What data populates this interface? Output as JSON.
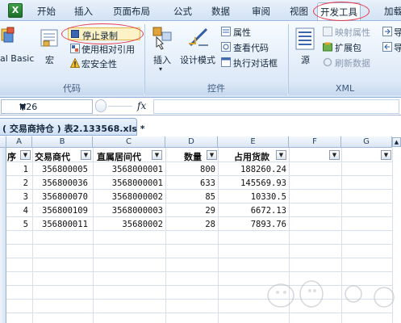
{
  "ribbon": {
    "tabs": [
      "开始",
      "插入",
      "页面布局",
      "公式",
      "数据",
      "审阅",
      "视图",
      "开发工具",
      "加载"
    ],
    "active_tab": "开发工具",
    "code_group": {
      "label": "代码",
      "macro_label": "宏",
      "visual_basic_partial": "al Basic",
      "stop_recording": "停止录制",
      "relative_ref": "使用相对引用",
      "macro_security": "宏安全性"
    },
    "controls_group": {
      "label": "控件",
      "insert": "插入",
      "design_mode": "设计模式",
      "properties": "属性",
      "view_code": "查看代码",
      "run_dialog": "执行对话框"
    },
    "xml_group": {
      "label": "XML",
      "source": "源",
      "map_properties": "映射属性",
      "expansion_pack": "扩展包",
      "refresh_data": "刷新数据",
      "import_partial": "导",
      "export_partial": "导"
    }
  },
  "formula_bar": {
    "name_box": "H26",
    "fx": "fx",
    "formula": ""
  },
  "workbook": {
    "title": "( 交易商持仓 ) 表2.133568.xls *"
  },
  "grid": {
    "columns": [
      "A",
      "B",
      "C",
      "D",
      "E",
      "F",
      "G"
    ],
    "headers": [
      "序",
      "交易商代",
      "直属居间代",
      "数量",
      "占用货款"
    ],
    "rows": [
      [
        "1",
        "356800005",
        "3568000001",
        "800",
        "188260.24"
      ],
      [
        "2",
        "356800036",
        "3568000001",
        "633",
        "145569.93"
      ],
      [
        "3",
        "356800070",
        "3568000002",
        "85",
        "10330.5"
      ],
      [
        "4",
        "356800109",
        "3568000003",
        "29",
        "6672.13"
      ],
      [
        "5",
        "356800011",
        "35680002",
        "28",
        "7893.76"
      ]
    ]
  },
  "colors": {
    "highlight_ellipse": "#e8394a",
    "ribbon_bg": "#dfeaf7"
  }
}
